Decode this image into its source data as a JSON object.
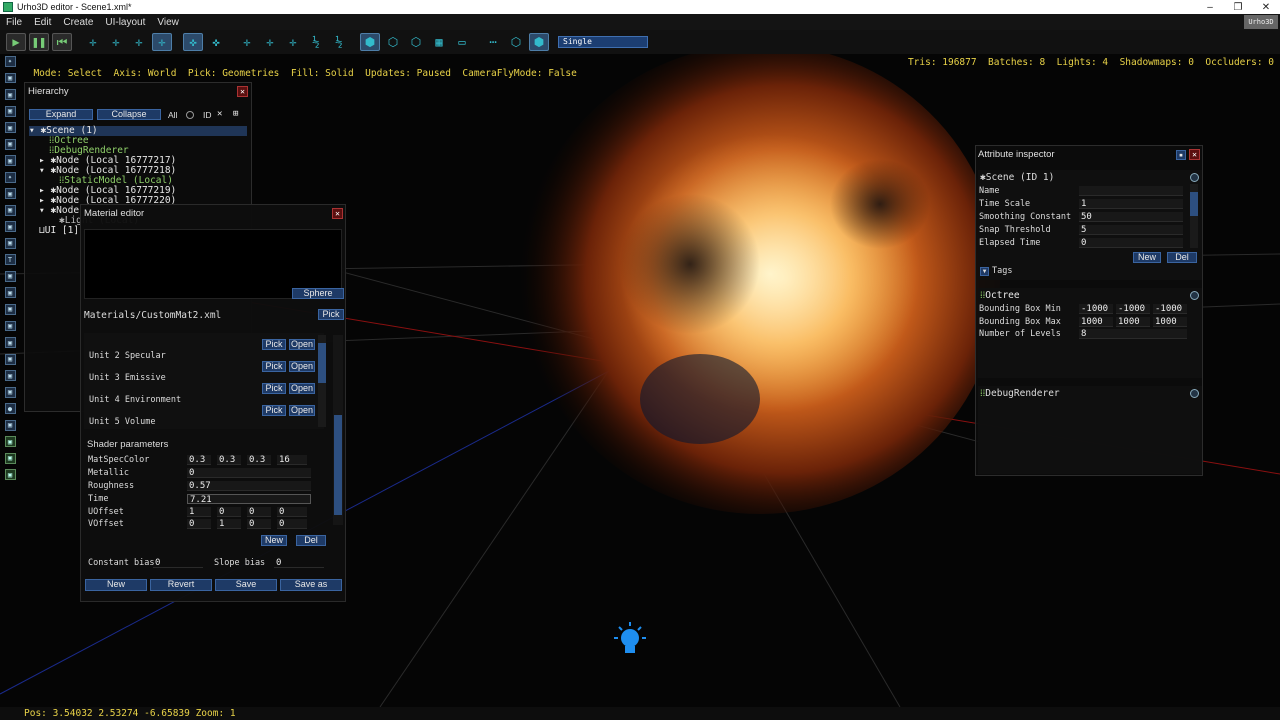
{
  "window": {
    "title": "Urho3D editor - Scene1.xml*",
    "controls": [
      "–",
      "❐",
      "✕"
    ]
  },
  "brand": "Urho3D",
  "menu": [
    "File",
    "Edit",
    "Create",
    "UI-layout",
    "View"
  ],
  "toolbar": {
    "render_path": "Single",
    "icons": [
      "play-icon",
      "pause-icon",
      "restart-icon",
      "move-icon",
      "rotate-icon",
      "scale-icon",
      "select-icon",
      "pick-geometries-icon",
      "pick-lights-icon",
      "world-axis-icon",
      "local-axis-icon",
      "snap-move-icon",
      "snap-rotate-icon",
      "snap-scale-icon",
      "fill-solid-icon",
      "fill-wire-icon",
      "fill-point-icon",
      "grid-icon",
      "camera-icon",
      "view-icon"
    ]
  },
  "status_left": "Mode: Select  Axis: World  Pick: Geometries  Fill: Solid  Updates: Paused  CameraFlyMode: False",
  "status_right": "Tris: 196877  Batches: 8  Lights: 4  Shadowmaps: 0  Occluders: 0",
  "hierarchy": {
    "title": "Hierarchy",
    "expand": "Expand",
    "collapse": "Collapse",
    "all": "All",
    "id": "ID",
    "items": [
      "Scene (1)",
      "Octree",
      "DebugRenderer",
      "Node (Local 16777217)",
      "Node (Local 16777218)",
      "StaticModel (Local)",
      "Node (Local 16777219)",
      "Node (Local 16777220)",
      "Node",
      "Light (Local)",
      "UI [1]"
    ]
  },
  "material_editor": {
    "title": "Material editor",
    "preview_shape": "Sphere",
    "file": "Materials/CustomMat2.xml",
    "pick": "Pick",
    "open": "Open",
    "units": [
      "Unit 2 Specular",
      "Unit 3 Emissive",
      "Unit 4 Environment",
      "Unit 5 Volume"
    ],
    "shader_params_title": "Shader parameters",
    "params": [
      {
        "name": "MatSpecColor",
        "values": [
          "0.3",
          "0.3",
          "0.3",
          "16"
        ]
      },
      {
        "name": "Metallic",
        "values": [
          "0"
        ]
      },
      {
        "name": "Roughness",
        "values": [
          "0.57"
        ]
      },
      {
        "name": "Time",
        "values": [
          "7.21"
        ]
      },
      {
        "name": "UOffset",
        "values": [
          "1",
          "0",
          "0",
          "0"
        ]
      },
      {
        "name": "VOffset",
        "values": [
          "0",
          "1",
          "0",
          "0"
        ]
      }
    ],
    "new": "New",
    "del": "Del",
    "constant_bias": "Constant bias",
    "constant_bias_value": "0",
    "slope_bias": "Slope bias",
    "slope_bias_value": "0",
    "buttons": [
      "New",
      "Revert",
      "Save",
      "Save as"
    ]
  },
  "attribute_inspector": {
    "title": "Attribute inspector",
    "scene_header": "Scene (ID 1)",
    "scene_attrs": [
      {
        "name": "Name",
        "value": ""
      },
      {
        "name": "Time Scale",
        "value": "1"
      },
      {
        "name": "Smoothing Constant",
        "value": "50"
      },
      {
        "name": "Snap Threshold",
        "value": "5"
      },
      {
        "name": "Elapsed Time",
        "value": "0"
      }
    ],
    "new": "New",
    "del": "Del",
    "tags": "Tags",
    "octree_header": "Octree",
    "octree_attrs": [
      {
        "name": "Bounding Box Min",
        "values": [
          "-1000",
          "-1000",
          "-1000"
        ]
      },
      {
        "name": "Bounding Box Max",
        "values": [
          "1000",
          "1000",
          "1000"
        ]
      },
      {
        "name": "Number of Levels",
        "values": [
          "8"
        ]
      }
    ],
    "debug_header": "DebugRenderer"
  },
  "footer": "Pos: 3.54032  2.53274  -6.65839 Zoom: 1",
  "colors": {
    "accent": "#1e3a66",
    "status_text": "#e8d248",
    "tree_component": "#8fd06a"
  }
}
